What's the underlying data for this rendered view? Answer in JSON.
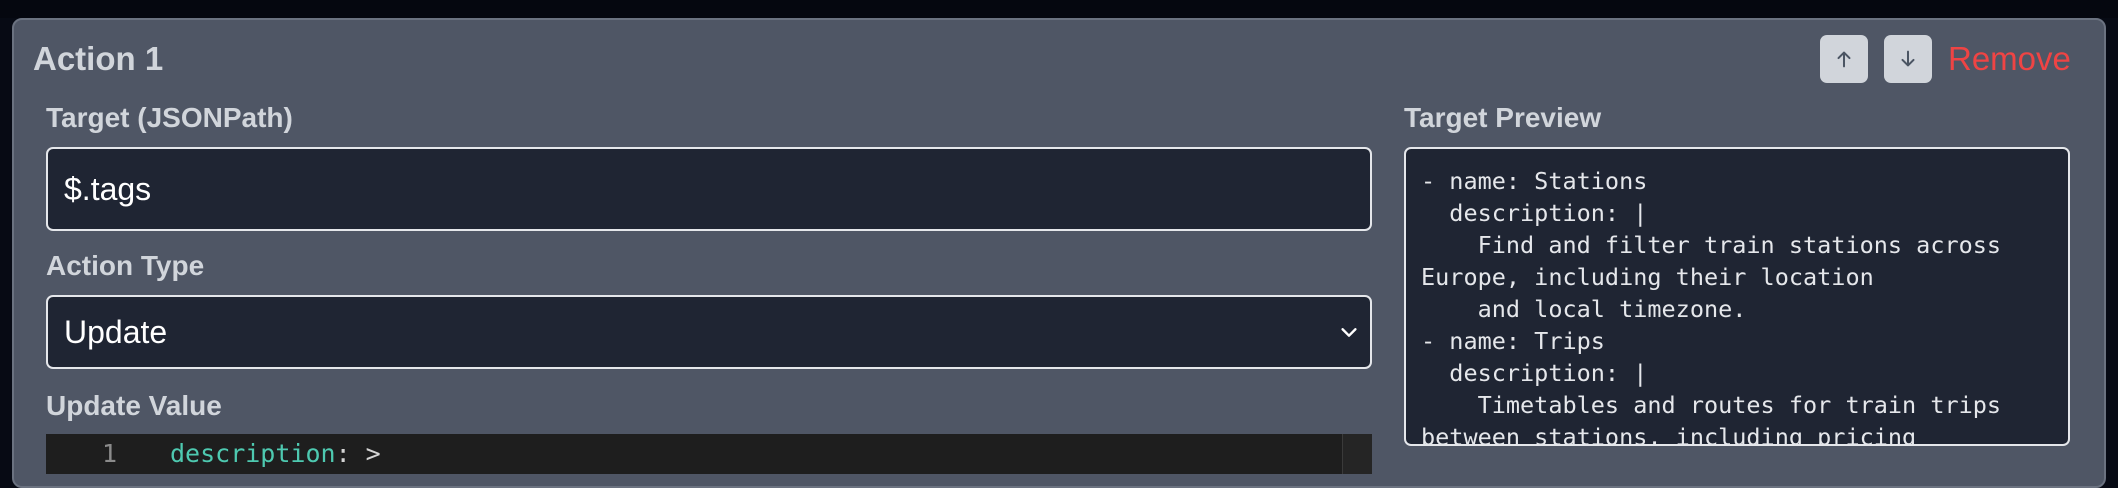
{
  "action": {
    "title": "Action 1",
    "remove_label": "Remove",
    "move_up_icon": "arrow-up-icon",
    "move_down_icon": "arrow-down-icon"
  },
  "target": {
    "label": "Target (JSONPath)",
    "value": "$.tags"
  },
  "action_type": {
    "label": "Action Type",
    "selected": "Update"
  },
  "update_value": {
    "label": "Update Value",
    "lines": [
      {
        "number": "1",
        "key": "description",
        "rest": ": >"
      }
    ]
  },
  "preview": {
    "label": "Target Preview",
    "text": "- name: Stations\n  description: |\n    Find and filter train stations across\nEurope, including their location\n    and local timezone.\n- name: Trips\n  description: |\n    Timetables and routes for train trips\nbetween stations, including pricing"
  },
  "colors": {
    "card_bg": "#4f5665",
    "input_bg": "#1f2533",
    "remove": "#ef4444",
    "editor_bg": "#1e1e1e",
    "yaml_key": "#4ec9b0"
  }
}
